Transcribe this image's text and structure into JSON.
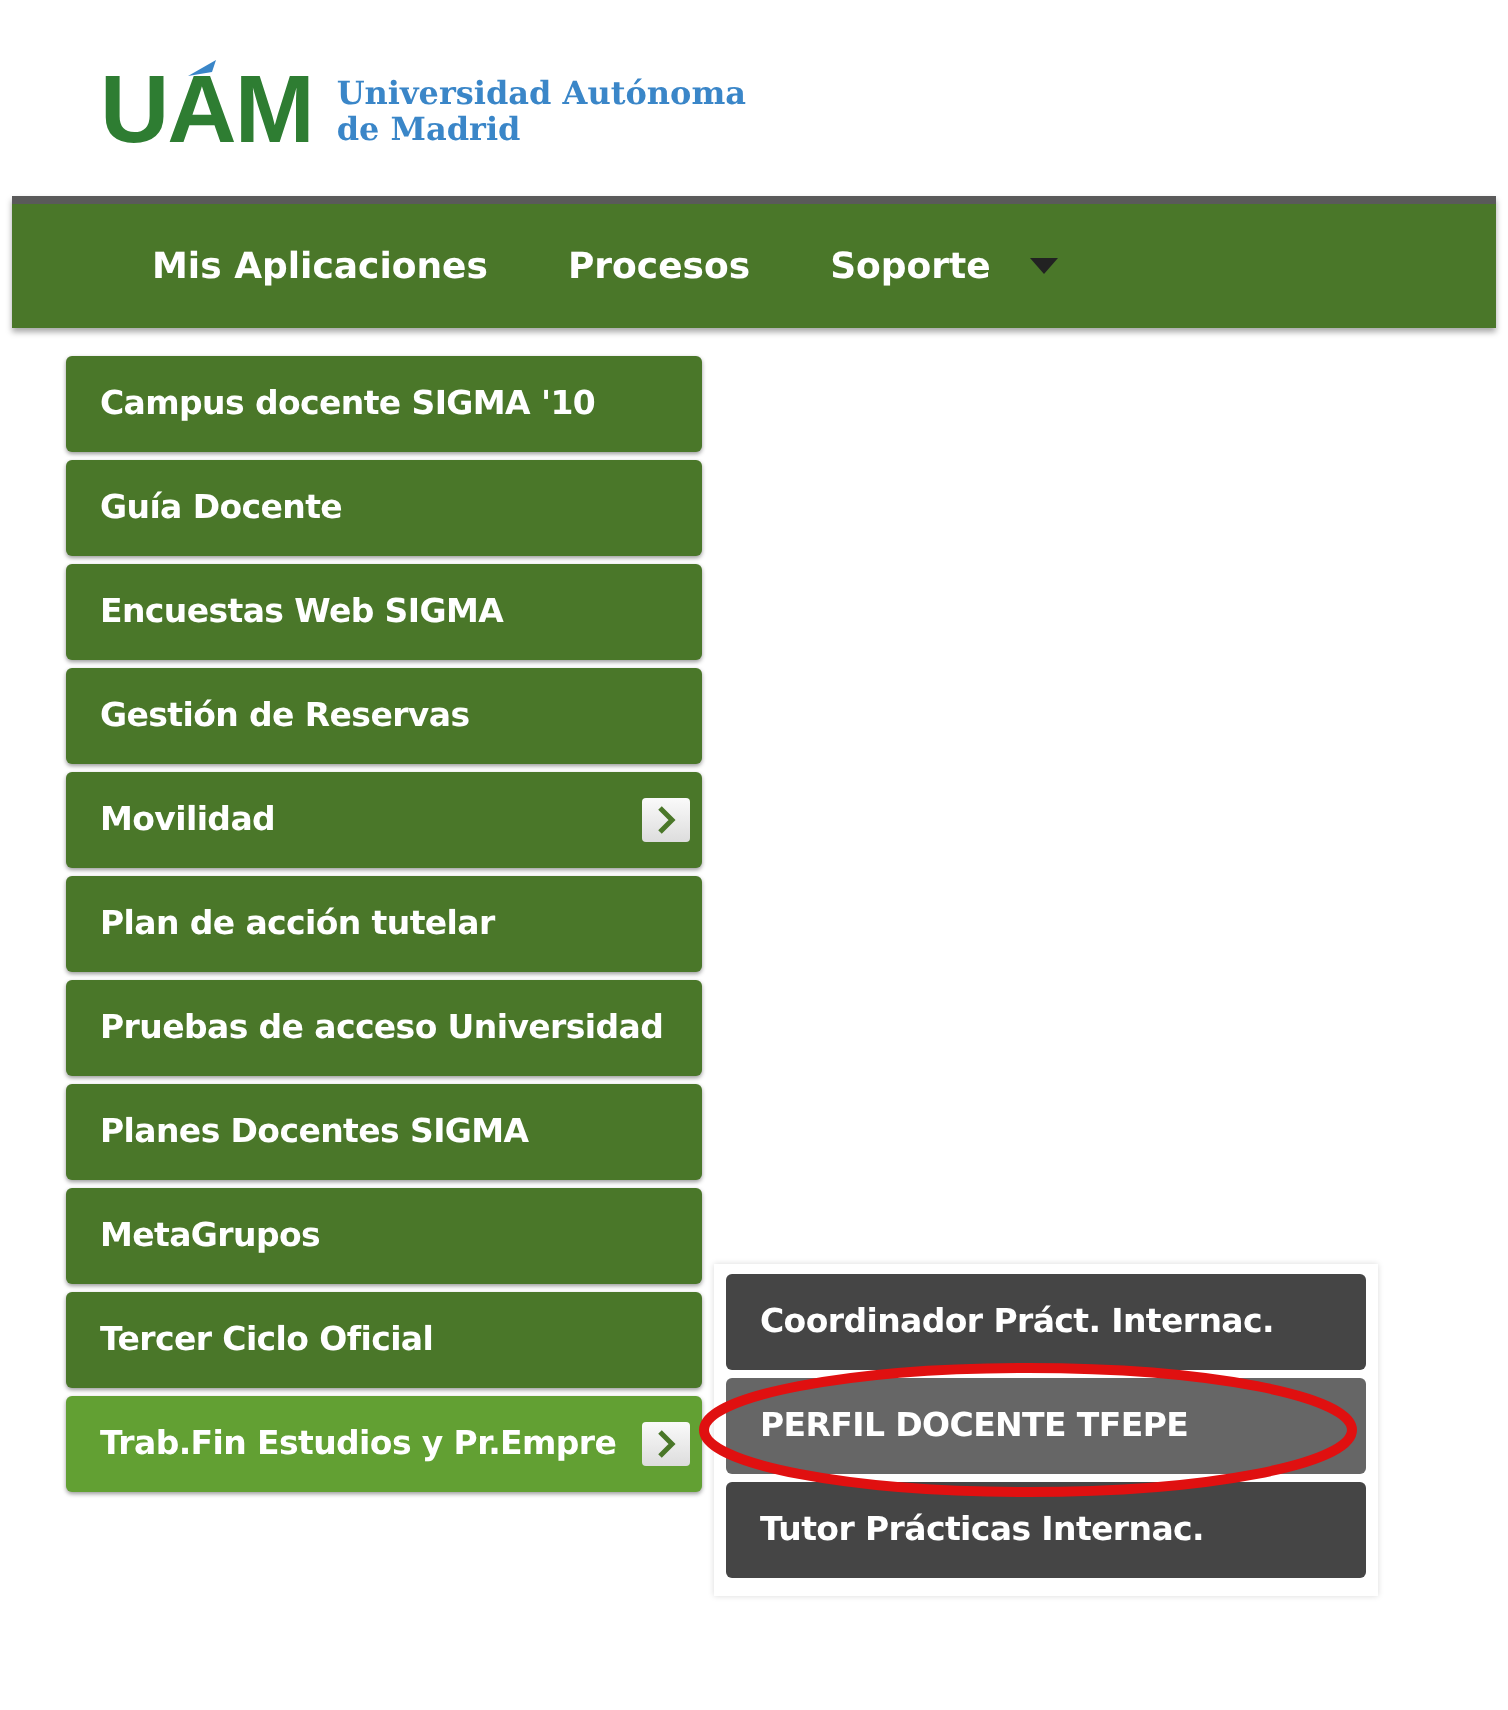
{
  "logo": {
    "mark": "UAM",
    "name_lines": [
      "Universidad Autónoma",
      "de Madrid"
    ]
  },
  "navbar": {
    "items": [
      {
        "label": "Mis Aplicaciones",
        "has_dropdown": false
      },
      {
        "label": "Procesos",
        "has_dropdown": false
      },
      {
        "label": "Soporte",
        "has_dropdown": true
      }
    ]
  },
  "menu": {
    "items": [
      {
        "label": "Campus docente SIGMA '10",
        "has_submenu": false,
        "selected": false
      },
      {
        "label": "Guía Docente",
        "has_submenu": false,
        "selected": false
      },
      {
        "label": "Encuestas Web SIGMA",
        "has_submenu": false,
        "selected": false
      },
      {
        "label": "Gestión de Reservas",
        "has_submenu": false,
        "selected": false
      },
      {
        "label": "Movilidad",
        "has_submenu": true,
        "selected": false
      },
      {
        "label": "Plan de acción tutelar",
        "has_submenu": false,
        "selected": false
      },
      {
        "label": "Pruebas de acceso Universidad",
        "has_submenu": false,
        "selected": false
      },
      {
        "label": "Planes Docentes SIGMA",
        "has_submenu": false,
        "selected": false
      },
      {
        "label": "MetaGrupos",
        "has_submenu": false,
        "selected": false
      },
      {
        "label": "Tercer Ciclo Oficial",
        "has_submenu": false,
        "selected": false
      },
      {
        "label": "Trab.Fin Estudios y Pr.Empre",
        "has_submenu": true,
        "selected": true
      }
    ]
  },
  "submenu": {
    "items": [
      {
        "label": "Coordinador Práct. Internac.",
        "selected": false,
        "circled": false
      },
      {
        "label": "PERFIL DOCENTE TFEPE",
        "selected": true,
        "circled": true
      },
      {
        "label": "Tutor Prácticas Internac.",
        "selected": false,
        "circled": false
      }
    ]
  }
}
